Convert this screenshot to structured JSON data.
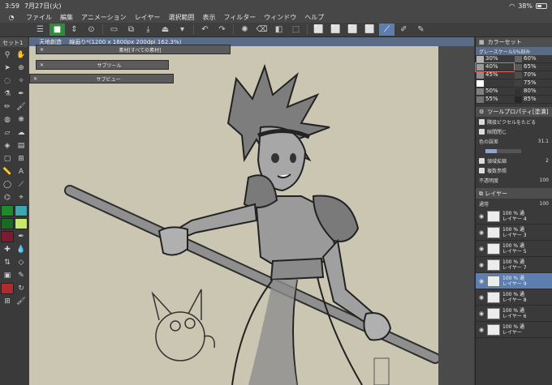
{
  "status": {
    "time": "3:59",
    "date": "7月27日(火)",
    "battery": "38%"
  },
  "menu": [
    "ファイル",
    "編集",
    "アニメーション",
    "レイヤー",
    "選択範囲",
    "表示",
    "フィルター",
    "ウィンドウ",
    "ヘルプ"
  ],
  "document": {
    "title": "天地創造 　線画り*(1200 x 1600px 200dpi 162.3%)"
  },
  "left_panel": {
    "title": "セット1"
  },
  "float_panels": [
    {
      "title": "素材[すべての素材]"
    },
    {
      "title": "サブツール"
    },
    {
      "title": "サブビュー"
    }
  ],
  "colors": {
    "accent": "#5d7fb0",
    "paper": "#cac6b2",
    "selected_outline": "#e06a6a"
  },
  "grayscale_panel": {
    "title": "カラーセット",
    "set_name": "グレースケール5%刻み",
    "swatches": [
      {
        "label": "30%",
        "color": "#b3b3b3"
      },
      {
        "label": "60%",
        "color": "#666666"
      },
      {
        "label": "40%",
        "color": "#999999",
        "selected": true
      },
      {
        "label": "65%",
        "color": "#595959"
      },
      {
        "label": "45%",
        "color": "#8c8c8c"
      },
      {
        "label": "70%",
        "color": "#4d4d4d"
      },
      {
        "label": "",
        "color": "#ffffff"
      },
      {
        "label": "75%",
        "color": "#404040"
      },
      {
        "label": "50%",
        "color": "#808080"
      },
      {
        "label": "80%",
        "color": "#333333"
      },
      {
        "label": "55%",
        "color": "#737373"
      },
      {
        "label": "85%",
        "color": "#262626"
      }
    ]
  },
  "tool_property": {
    "title": "ツールプロパティ[塗潰]",
    "rows": [
      {
        "label": "隣接ピクセルをたどる",
        "value": ""
      },
      {
        "label": "隙間閉じ",
        "value": ""
      },
      {
        "label": "色の誤差",
        "value": "31.1"
      },
      {
        "label": "領域拡縮",
        "value": "2"
      },
      {
        "label": "複数参照",
        "value": ""
      },
      {
        "label": "不透明度",
        "value": "100"
      }
    ],
    "sliders": {
      "tolerance": 0.31,
      "expand": 0.1,
      "opacity": 1.0
    }
  },
  "layers": {
    "title": "レイヤー",
    "blend": "通常",
    "opacity": "100",
    "items": [
      {
        "pct": "100 %",
        "mode": "通",
        "name": "レイヤー 4"
      },
      {
        "pct": "100 %",
        "mode": "通",
        "name": "レイヤー 3"
      },
      {
        "pct": "100 %",
        "mode": "通",
        "name": "レイヤー 5"
      },
      {
        "pct": "100 %",
        "mode": "通",
        "name": "レイヤー 7"
      },
      {
        "pct": "100 %",
        "mode": "通",
        "name": "レイヤー 9",
        "selected": true
      },
      {
        "pct": "100 %",
        "mode": "通",
        "name": "レイヤー 8"
      },
      {
        "pct": "100 %",
        "mode": "通",
        "name": "レイヤー 6"
      },
      {
        "pct": "100 %",
        "mode": "通",
        "name": "レイヤー"
      }
    ]
  }
}
